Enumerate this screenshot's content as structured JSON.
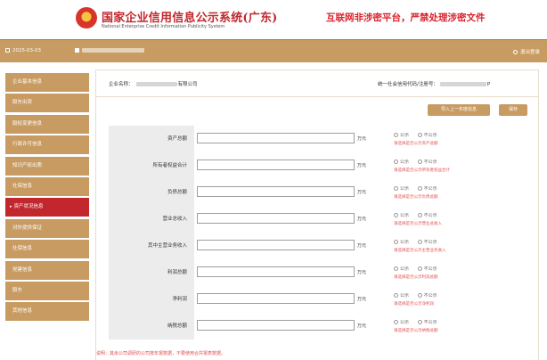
{
  "header": {
    "title": "国家企业信用信息公示系统(广东)",
    "subtitle": "National Enterprise Credit Information Publicity System",
    "notice": "互联网非涉密平台，严禁处理涉密文件"
  },
  "toolbar": {
    "date": "2025-03-03",
    "user_suffix": "",
    "logout": "退出登录"
  },
  "sidebar": {
    "items": [
      {
        "label": "企业基本信息",
        "active": false
      },
      {
        "label": "股东出资",
        "active": false
      },
      {
        "label": "股权变更信息",
        "active": false
      },
      {
        "label": "行政许可信息",
        "active": false
      },
      {
        "label": "知识产权出质",
        "active": false
      },
      {
        "label": "社保信息",
        "active": false
      },
      {
        "label": "资产状况信息",
        "active": true
      },
      {
        "label": "对外提供保证",
        "active": false
      },
      {
        "label": "社保信息",
        "active": false
      },
      {
        "label": "党建信息",
        "active": false
      },
      {
        "label": "股东",
        "active": false
      },
      {
        "label": "其他信息",
        "active": false
      }
    ]
  },
  "company": {
    "name_label": "企业名称：",
    "name_suffix": "有限公司",
    "code_label": "统一社会信用代码/注册号：",
    "code_suffix": "P"
  },
  "buttons": {
    "import": "导入上一年度信息",
    "save": "保存"
  },
  "form": {
    "rows": [
      {
        "label": "资产总额",
        "unit": "万元",
        "public": "公示",
        "private": "不公示",
        "hint": "请选择是否公示资产总额"
      },
      {
        "label": "所有者权益合计",
        "unit": "万元",
        "public": "公示",
        "private": "不公示",
        "hint": "请选择是否公示所有者权益合计"
      },
      {
        "label": "负债总额",
        "unit": "万元",
        "public": "公示",
        "private": "不公示",
        "hint": "请选择是否公示负债总额"
      },
      {
        "label": "营业总收入",
        "unit": "万元",
        "public": "公示",
        "private": "不公示",
        "hint": "请选择是否公示营业总收入"
      },
      {
        "label": "其中主营业务收入",
        "unit": "万元",
        "public": "公示",
        "private": "不公示",
        "hint": "请选择是否公示主营业务收入"
      },
      {
        "label": "利润总额",
        "unit": "万元",
        "public": "公示",
        "private": "不公示",
        "hint": "请选择是否公示利润总额"
      },
      {
        "label": "净利润",
        "unit": "万元",
        "public": "公示",
        "private": "不公示",
        "hint": "请选择是否公示净利润"
      },
      {
        "label": "纳税总额",
        "unit": "万元",
        "public": "公示",
        "private": "不公示",
        "hint": "请选择是否公示纳税总额"
      }
    ]
  },
  "footnote": "说明：其余公司调研的公司按年报数据，不要使用合并报表数据。",
  "colors": {
    "brand_gold": "#c89b62",
    "brand_red": "#c1272d",
    "hint_red": "#e25252"
  }
}
